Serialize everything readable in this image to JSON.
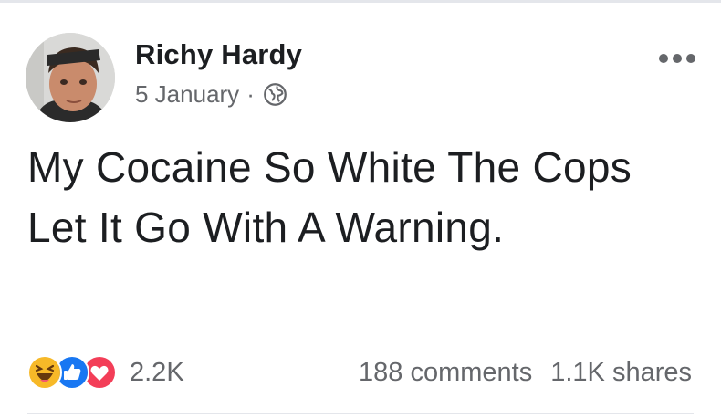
{
  "post": {
    "author": "Richy Hardy",
    "date": "5 January",
    "separator": "·",
    "privacy_icon": "globe-icon",
    "menu_icon": "more-options-icon",
    "text": "My Cocaine So White The Cops Let It Go With A Warning."
  },
  "reactions": {
    "icons": [
      "haha-icon",
      "like-icon",
      "love-icon"
    ],
    "count": "2.2K"
  },
  "stats": {
    "comments": "188 comments",
    "shares": "1.1K shares"
  },
  "colors": {
    "text": "#1c1e21",
    "secondary": "#65676b",
    "like_blue": "#1877f2",
    "love_red": "#f33e58",
    "haha_yellow": "#f7b928"
  }
}
